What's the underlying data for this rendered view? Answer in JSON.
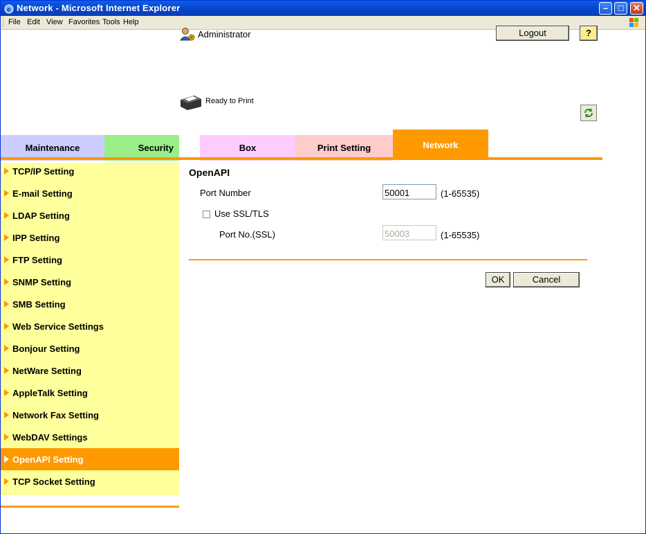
{
  "window": {
    "title": "Network - Microsoft Internet Explorer"
  },
  "menu": [
    "File",
    "Edit",
    "View",
    "Favorites",
    "Tools",
    "Help"
  ],
  "header": {
    "user_label": "Administrator",
    "logout_label": "Logout",
    "help_label": "?",
    "status_label": "Ready to Print"
  },
  "tabs": [
    {
      "label": "Maintenance",
      "color": "#ccccff"
    },
    {
      "label": "Security",
      "color": "#99ee88"
    },
    {
      "label": "Box",
      "color": "#ffccff"
    },
    {
      "label": "Print Setting",
      "color": "#ffcccc"
    },
    {
      "label": "Network",
      "color": "#ff9900",
      "active": true
    }
  ],
  "sidebar": {
    "items": [
      {
        "label": "TCP/IP Setting"
      },
      {
        "label": "E-mail Setting"
      },
      {
        "label": "LDAP Setting"
      },
      {
        "label": "IPP Setting"
      },
      {
        "label": "FTP Setting"
      },
      {
        "label": "SNMP Setting"
      },
      {
        "label": "SMB Setting"
      },
      {
        "label": "Web Service Settings"
      },
      {
        "label": "Bonjour Setting"
      },
      {
        "label": "NetWare Setting"
      },
      {
        "label": "AppleTalk Setting"
      },
      {
        "label": "Network Fax Setting"
      },
      {
        "label": "WebDAV Settings"
      },
      {
        "label": "OpenAPI Setting",
        "active": true
      },
      {
        "label": "TCP Socket Setting"
      }
    ]
  },
  "main": {
    "heading": "OpenAPI",
    "port_label": "Port Number",
    "port_value": "50001",
    "port_range": "(1-65535)",
    "ssl_label": "Use SSL/TLS",
    "ssl_checked": false,
    "ssl_port_label": "Port No.(SSL)",
    "ssl_port_value": "50003",
    "ssl_port_range": "(1-65535)",
    "ok_label": "OK",
    "cancel_label": "Cancel"
  },
  "colors": {
    "accent": "#ff9900",
    "sidebar_bg": "#ffff9c",
    "titlebar": "#0842c7"
  }
}
